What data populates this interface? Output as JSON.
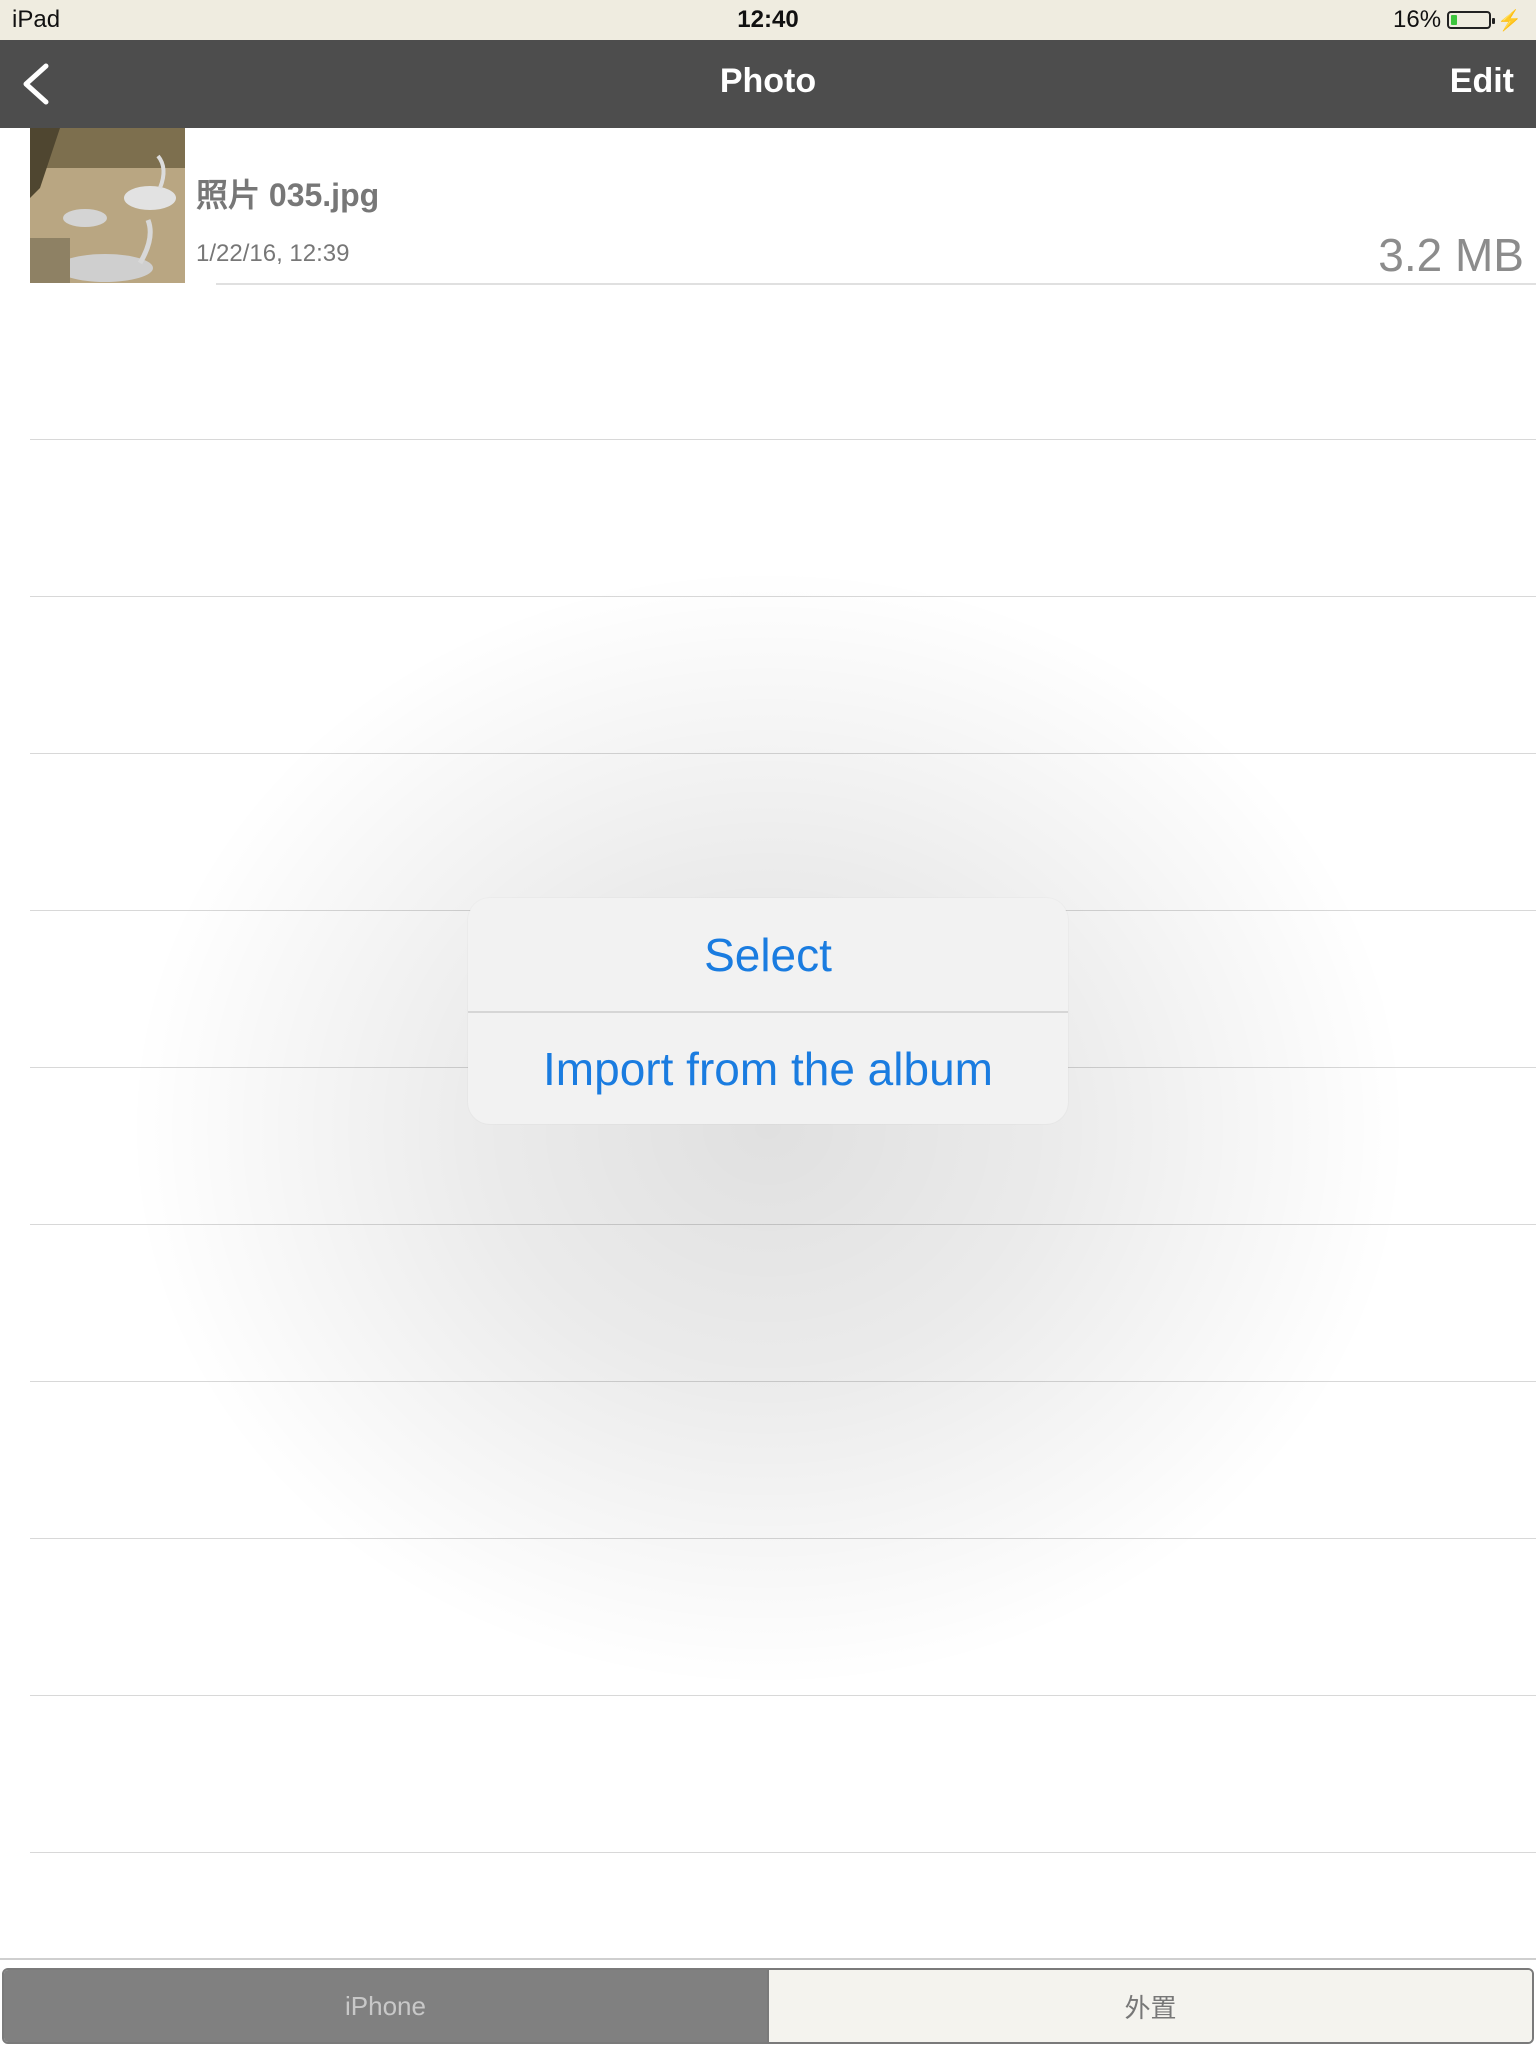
{
  "status_bar": {
    "device": "iPad",
    "time": "12:40",
    "battery_percent": "16%",
    "battery_level": 0.16,
    "charging_icon": "lightning-bolt-icon"
  },
  "nav": {
    "back_icon": "chevron-left-icon",
    "title": "Photo",
    "edit_label": "Edit"
  },
  "files": [
    {
      "name": "照片 035.jpg",
      "date": "1/22/16, 12:39",
      "size": "3.2 MB",
      "thumbnail_icon": "photo-thumbnail"
    }
  ],
  "action_sheet": {
    "select_label": "Select",
    "import_label": "Import from the album",
    "accent_color": "#1a7ce0"
  },
  "tabs": {
    "iphone_label": "iPhone",
    "external_label": "外置",
    "selected": "iPhone"
  },
  "colors": {
    "nav_background": "#4d4d4d",
    "status_background": "#efece0"
  }
}
